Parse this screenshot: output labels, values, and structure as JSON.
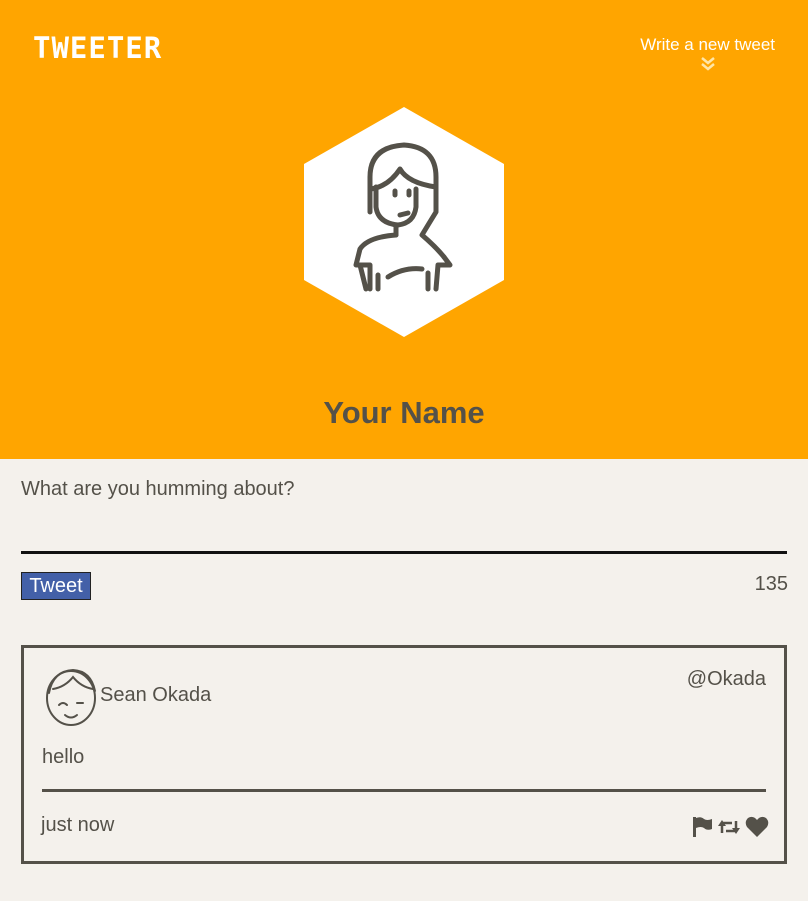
{
  "header": {
    "logo": "TWEETER",
    "write_link": "Write a new tweet",
    "profile_name": "Your Name",
    "background_color": "#ffa500"
  },
  "composer": {
    "label": "What are you humming about?",
    "value": "",
    "tweet_button": "Tweet",
    "char_count": "135",
    "button_color": "#4360a8"
  },
  "tweets": [
    {
      "user_name": "Sean Okada",
      "handle": "@Okada",
      "text": "hello",
      "timestamp": "just now",
      "actions": [
        "flag-icon",
        "retweet-icon",
        "heart-icon"
      ]
    }
  ]
}
